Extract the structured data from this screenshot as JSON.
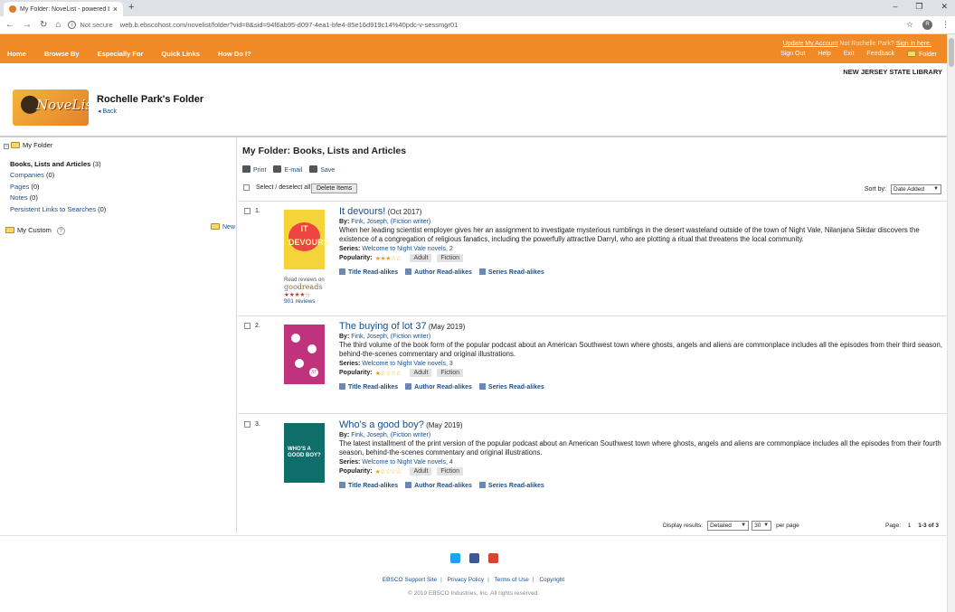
{
  "browser": {
    "tab_title": "My Folder: NoveList - powered b",
    "tab_close": "×",
    "new_tab": "+",
    "not_secure": "Not secure",
    "url": "web.b.ebscohost.com/novelist/folder?vid=8&sid=94f6ab95-d097-4ea1-bfe4-85e16d919c14%40pdc-v-sessmgr01",
    "avatar_letter": "R",
    "win_min": "–",
    "win_max": "❐",
    "win_close": "✕"
  },
  "topnav": {
    "menu": [
      "Home",
      "Browse By",
      "Especially For",
      "Quick Links",
      "How Do I?"
    ],
    "update_account": "Update My Account",
    "not_user": "Not Rochelle Park?",
    "sign_in": "Sign in here.",
    "utils": [
      "Sign Out",
      "Help",
      "Exit",
      "Feedback"
    ],
    "folder": "Folder"
  },
  "library_name": "NEW JERSEY STATE LIBRARY",
  "header": {
    "logo_text": "NoveList",
    "title": "Rochelle Park's Folder",
    "back": "Back"
  },
  "sidebar": {
    "root": "My Folder",
    "items": [
      {
        "label": "Books, Lists and Articles",
        "count": "(3)"
      },
      {
        "label": "Companies",
        "count": "(0)"
      },
      {
        "label": "Pages",
        "count": "(0)"
      },
      {
        "label": "Notes",
        "count": "(0)"
      },
      {
        "label": "Persistent Links to Searches",
        "count": "(0)"
      }
    ],
    "my_custom": "My Custom",
    "help": "?",
    "new": "New"
  },
  "main": {
    "title": "My Folder:  Books, Lists and Articles",
    "actions": [
      "Print",
      "E-mail",
      "Save"
    ],
    "select_all": "Select / deselect all",
    "delete": "Delete Items",
    "sort_label": "Sort by:",
    "sort_value": "Date Added"
  },
  "results": [
    {
      "num": "1.",
      "title": "It devours!",
      "date": "(Oct 2017)",
      "by_label": "By:",
      "author": "Fink, Joseph, (Fiction writer)",
      "description": "When her leading scientist employer gives her an assignment to investigate mysterious rumblings in the desert wasteland outside of the town of Night Vale, Nilanjana Sikdar discovers the existence of a congregation of religious fanatics, including the powerfully attractive Darryl, who are plotting a ritual that threatens the local community.",
      "series_label": "Series:",
      "series": "Welcome to Night Vale novels, 2",
      "popularity_label": "Popularity:",
      "popularity": 3,
      "tags": [
        "Adult",
        "Fiction"
      ],
      "cover_text": "IT DEVOURS",
      "goodreads_prefix": "Read reviews on",
      "goodreads_word": "goodreads",
      "goodreads_stars": "★★★★☆",
      "goodreads_reviews": "901 reviews"
    },
    {
      "num": "2.",
      "title": "The buying of lot 37",
      "date": "(May 2019)",
      "by_label": "By:",
      "author": "Fink, Joseph, (Fiction writer)",
      "description": "The third volume of the book form of the popular podcast about an American Southwest town where ghosts, angels and aliens are commonplace includes all the episodes from their third season, behind-the-scenes commentary and original illustrations.",
      "series_label": "Series:",
      "series": "Welcome to Night Vale novels, 3",
      "popularity_label": "Popularity:",
      "popularity": 1,
      "tags": [
        "Adult",
        "Fiction"
      ],
      "cover_text": "37"
    },
    {
      "num": "3.",
      "title": "Who's a good boy?",
      "date": "(May 2019)",
      "by_label": "By:",
      "author": "Fink, Joseph, (Fiction writer)",
      "description": "The latest installment of the print version of the popular podcast about an American Southwest town where ghosts, angels and aliens are commonplace includes all the episodes from their fourth season, behind-the-scenes commentary and original illustrations.",
      "series_label": "Series:",
      "series": "Welcome to Night Vale novels, 4",
      "popularity_label": "Popularity:",
      "popularity": 1,
      "tags": [
        "Adult",
        "Fiction"
      ],
      "cover_text": "WHO'S A GOOD BOY?"
    }
  ],
  "readalikes": [
    "Title Read-alikes",
    "Author Read-alikes",
    "Series Read-alikes"
  ],
  "pager": {
    "display_label": "Display results:",
    "display_value": "Detailed",
    "per_page_value": "30",
    "per_page_label": "per page",
    "page_label": "Page:",
    "page_num": "1",
    "range": "1-3 of 3"
  },
  "footer": {
    "links": [
      "EBSCO Support Site",
      "Privacy Policy",
      "Terms of Use",
      "Copyright"
    ],
    "copyright": "© 2019 EBSCO Industries, Inc. All rights reserved."
  },
  "colors": {
    "accent": "#f08a26",
    "link": "#1a4f8b"
  }
}
